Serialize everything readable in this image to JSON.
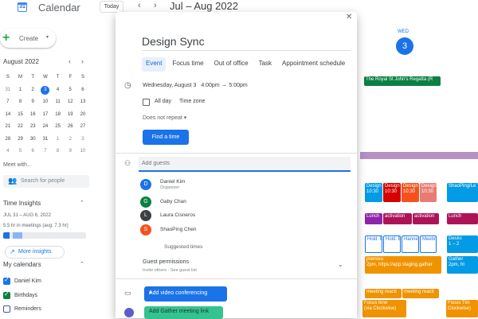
{
  "topbar": {
    "app_title": "Calendar",
    "logo_day": "31",
    "today_label": "Today",
    "range_title": "Jul – Aug 2022"
  },
  "sidebar": {
    "create_label": "Create",
    "mini_cal": {
      "month_title": "August 2022",
      "weekdays": [
        "S",
        "M",
        "T",
        "W",
        "T",
        "F",
        "S"
      ],
      "weeks": [
        [
          "31",
          "1",
          "2",
          "3",
          "4",
          "5",
          "6"
        ],
        [
          "7",
          "8",
          "9",
          "10",
          "11",
          "12",
          "13"
        ],
        [
          "14",
          "15",
          "16",
          "17",
          "18",
          "19",
          "20"
        ],
        [
          "21",
          "22",
          "23",
          "24",
          "25",
          "26",
          "27"
        ],
        [
          "28",
          "29",
          "30",
          "31",
          "1",
          "2",
          "3"
        ],
        [
          "4",
          "5",
          "6",
          "7",
          "8",
          "9",
          "10"
        ]
      ],
      "selected": "3"
    },
    "meet_with": "Meet with...",
    "search_people": "Search for people",
    "time_insights": "Time Insights",
    "ti_range": "JUL 31 – AUG 6, 2022",
    "ti_hours": "5.5 hr in meetings (avg: 7.3 hr)",
    "ti_meeting_fraction": 0.08,
    "more_insights": "More insights",
    "my_calendars": "My calendars",
    "calendars": [
      {
        "label": "Daniel Kim",
        "color": "#1a73e8",
        "checked": true
      },
      {
        "label": "Birthdays",
        "color": "#0b8043",
        "checked": true
      },
      {
        "label": "Reminders",
        "color": "#3f51b5",
        "checked": false
      }
    ]
  },
  "week": {
    "day_label": "WED",
    "day_number": "3",
    "allday_event": "The Royal St John's Regatta (R",
    "events": [
      {
        "text": "Design\n10:30",
        "color": "#039be5",
        "col": 0,
        "row": 0
      },
      {
        "text": "Design\n10:30",
        "color": "#d50000",
        "col": 1,
        "row": 0
      },
      {
        "text": "Design\n10:30",
        "color": "#f4511e",
        "col": 2,
        "row": 0
      },
      {
        "text": "Design\n10:30",
        "color": "#e67c73",
        "col": 3,
        "row": 0
      },
      {
        "text": "ShaoPing/Le",
        "color": "#039be5",
        "col": 4,
        "row": 0
      },
      {
        "text": "Lunch",
        "color": "#8e24aa",
        "col": 0,
        "row": 1
      },
      {
        "text": "activation",
        "color": "#ad1457",
        "col": 1,
        "row": 1
      },
      {
        "text": "activation",
        "color": "#ad1457",
        "col": 2,
        "row": 1
      },
      {
        "text": "Lunch",
        "color": "#ad1457",
        "col": 4,
        "row": 1
      },
      {
        "text": "Hold. E",
        "color": "#fff",
        "col": 0,
        "row": 2
      },
      {
        "text": "Hold. E",
        "color": "#fff",
        "col": 1,
        "row": 2
      },
      {
        "text": "Hanne",
        "color": "#fff",
        "col": 2,
        "row": 2
      },
      {
        "text": "Meetin",
        "color": "#fff",
        "col": 3,
        "row": 2
      },
      {
        "text": "Desks\n1 – 2",
        "color": "#039be5",
        "col": 4,
        "row": 2
      },
      {
        "text": "jinen/eu\n2pm, https://app.staging.gather",
        "color": "#f09300",
        "col": 0,
        "row": 3
      },
      {
        "text": "Gather\n2pm, ht",
        "color": "#039be5",
        "col": 4,
        "row": 3
      },
      {
        "text": "meeting reacti",
        "color": "#f09300",
        "col": 0,
        "row": 4
      },
      {
        "text": "meeting reacti",
        "color": "#f09300",
        "col": 1,
        "row": 4
      },
      {
        "text": "Focus time\n(via Clockwise)",
        "color": "#f09300",
        "col": 0,
        "row": 5
      },
      {
        "text": "Focus Tim\nClockwise)",
        "color": "#f09300",
        "col": 4,
        "row": 5
      }
    ]
  },
  "dialog": {
    "close_icon": "close-icon",
    "title": "Design Sync",
    "tabs": [
      "Event",
      "Focus time",
      "Out of office",
      "Task",
      "Appointment schedule"
    ],
    "active_tab": "Event",
    "datetime": {
      "date": "Wednesday, August 3",
      "start": "4:00pm",
      "sep": "–",
      "end": "5:00pm"
    },
    "all_day": "All day",
    "time_zone": "Time zone",
    "repeat": "Does not repeat",
    "find_time": "Find a time",
    "guests_placeholder": "Add guests",
    "guests": [
      {
        "name": "Daniel Kim",
        "role": "Organizer",
        "initial": "D",
        "color": "#1a73e8"
      },
      {
        "name": "Gaby Chan",
        "role": "",
        "initial": "G",
        "color": "#0b8043"
      },
      {
        "name": "Laura Cisneros",
        "role": "",
        "initial": "L",
        "color": "#3c4043"
      },
      {
        "name": "ShaoPing Chen",
        "role": "",
        "initial": "S",
        "color": "#f4511e"
      }
    ],
    "suggested_times": "Suggested times",
    "guest_permissions": "Guest permissions",
    "guest_permissions_sub": "Invite others · See guest list",
    "video_btn": "Add video conferencing",
    "gather_btn": "Add Gather meeting link"
  }
}
